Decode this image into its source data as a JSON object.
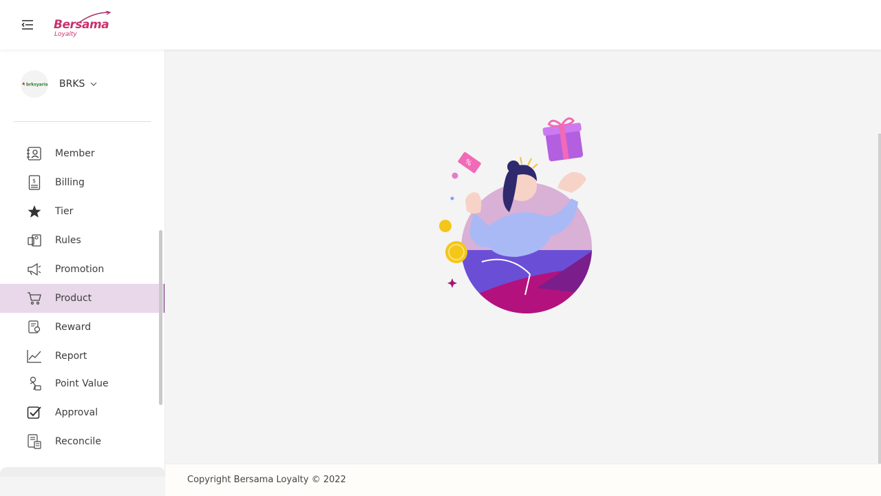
{
  "header": {
    "logo_text": "Bersama",
    "logo_subtext": "Loyalty"
  },
  "sidebar": {
    "org_name": "BRKS",
    "org_logo_text": "brksyariah",
    "items": [
      {
        "label": "Member",
        "icon": "member-card-icon"
      },
      {
        "label": "Billing",
        "icon": "billing-icon"
      },
      {
        "label": "Tier",
        "icon": "star-icon"
      },
      {
        "label": "Rules",
        "icon": "rules-icon"
      },
      {
        "label": "Promotion",
        "icon": "megaphone-icon"
      },
      {
        "label": "Product",
        "icon": "cart-icon",
        "active": true
      },
      {
        "label": "Reward",
        "icon": "reward-icon"
      },
      {
        "label": "Report",
        "icon": "chart-line-icon"
      },
      {
        "label": "Point Value",
        "icon": "point-value-icon"
      },
      {
        "label": "Approval",
        "icon": "check-square-icon"
      },
      {
        "label": "Reconcile",
        "icon": "reconcile-icon"
      }
    ]
  },
  "footer": {
    "copyright": "Copyright Bersama Loyalty © 2022"
  },
  "colors": {
    "brand": "#c8326e",
    "active_bg": "#e8d8e9",
    "active_accent": "#7a2a7f"
  }
}
